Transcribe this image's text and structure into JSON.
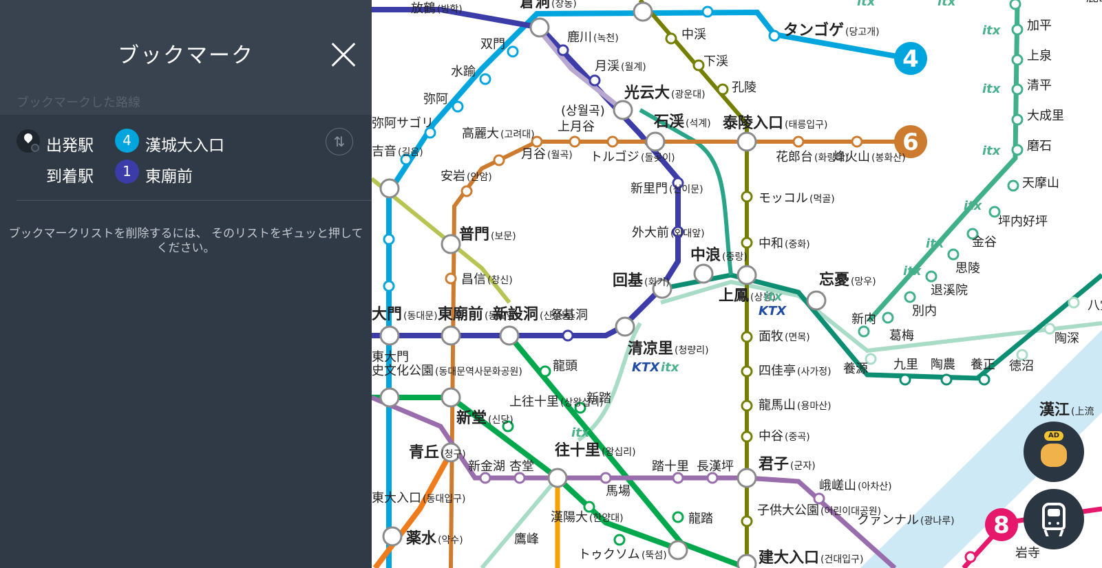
{
  "panel": {
    "title": "ブックマーク",
    "section_label": "ブックマークした路線",
    "origin_label": "出発駅",
    "destination_label": "到着駅",
    "origin": {
      "line_num": "4",
      "line_color": "#00a5de",
      "station": "漢城大入口"
    },
    "destination": {
      "line_num": "1",
      "line_color": "#3c3ca8",
      "station": "東廟前"
    },
    "note": "ブックマークリストを削除するには、 そのリストをギュッと押してください。"
  },
  "map": {
    "colors": {
      "line1": "#3c3ca8",
      "line2": "#00a84d",
      "line3": "#ef7c1c",
      "line4": "#00a5de",
      "line5": "#996cac",
      "line6": "#cd7c2f",
      "line7": "#747f00",
      "line8": "#e6186c",
      "gyeongui": "#77c4a3",
      "gyeongchun": "#0c8e72",
      "ujin": "#b7c452",
      "suin": "#f5a200",
      "han_river": "#c8e6f5"
    },
    "line_badges": [
      {
        "num": "4",
        "color": "#00a5de"
      },
      {
        "num": "6",
        "color": "#cd7c2f"
      },
      {
        "num": "8",
        "color": "#e6186c"
      }
    ],
    "stations": [
      {
        "jp": "放鶴",
        "kr": "(방학)"
      },
      {
        "jp": "倉洞",
        "kr": "(창동)"
      },
      {
        "jp": "中渓",
        "kr": ""
      },
      {
        "jp": "タンゴゲ",
        "kr": "(당고개)"
      },
      {
        "jp": "双門",
        "kr": ""
      },
      {
        "jp": "鹿川",
        "kr": "(녹천)"
      },
      {
        "jp": "下渓",
        "kr": ""
      },
      {
        "jp": "孔陵",
        "kr": ""
      },
      {
        "jp": "水踰",
        "kr": ""
      },
      {
        "jp": "月渓",
        "kr": "(월계)"
      },
      {
        "jp": "光云大",
        "kr": "(광운대)"
      },
      {
        "jp": "弥阿",
        "kr": ""
      },
      {
        "jp": "弥阿サゴリ",
        "kr": ""
      },
      {
        "jp": "吉音",
        "kr": "(길음)"
      },
      {
        "jp": "石渓",
        "kr": "(석계)"
      },
      {
        "jp": "泰陵入口",
        "kr": "(태릉입구)"
      },
      {
        "jp": "(상월곡)",
        "kr": ""
      },
      {
        "jp": "上月谷",
        "kr": ""
      },
      {
        "jp": "高麗大",
        "kr": "(고려대)"
      },
      {
        "jp": "月谷",
        "kr": "(월곡)"
      },
      {
        "jp": "トルゴジ",
        "kr": "(돌곶이)"
      },
      {
        "jp": "花郎台",
        "kr": "(화랑대)"
      },
      {
        "jp": "烽火山",
        "kr": "(봉화산)"
      },
      {
        "jp": "安岩",
        "kr": "(안암)"
      },
      {
        "jp": "新里門",
        "kr": "(신이문)"
      },
      {
        "jp": "モッコル",
        "kr": "(먹골)"
      },
      {
        "jp": "外大前",
        "kr": "(외대앞)"
      },
      {
        "jp": "中和",
        "kr": "(중화)"
      },
      {
        "jp": "普門",
        "kr": "(보문)"
      },
      {
        "jp": "中浪",
        "kr": "(중랑)"
      },
      {
        "jp": "昌信",
        "kr": "(창신)"
      },
      {
        "jp": "回基",
        "kr": "(회기)"
      },
      {
        "jp": "上鳳",
        "kr": "(상봉)"
      },
      {
        "jp": "忘憂",
        "kr": "(망우)"
      },
      {
        "jp": "大門",
        "kr": "(동대문)"
      },
      {
        "jp": "東廟前",
        "kr": "(동묘앞)"
      },
      {
        "jp": "新設洞",
        "kr": "(신설동)"
      },
      {
        "jp": "祭基洞",
        "kr": ""
      },
      {
        "jp": "清凉里",
        "kr": "(청량리)"
      },
      {
        "jp": "新内",
        "kr": ""
      },
      {
        "jp": "葛梅",
        "kr": ""
      },
      {
        "jp": "別内",
        "kr": ""
      },
      {
        "jp": "退溪院",
        "kr": ""
      },
      {
        "jp": "思陵",
        "kr": ""
      },
      {
        "jp": "面牧",
        "kr": "(면목)"
      },
      {
        "jp": "東大門",
        "kr": ""
      },
      {
        "jp": "史文化公園",
        "kr": "(동대문역사문화공원)"
      },
      {
        "jp": "龍頭",
        "kr": ""
      },
      {
        "jp": "四佳亭",
        "kr": "(사가정)"
      },
      {
        "jp": "養源",
        "kr": ""
      },
      {
        "jp": "九里",
        "kr": ""
      },
      {
        "jp": "陶農",
        "kr": ""
      },
      {
        "jp": "養正",
        "kr": ""
      },
      {
        "jp": "徳沼",
        "kr": ""
      },
      {
        "jp": "陶深",
        "kr": ""
      },
      {
        "jp": "新踏",
        "kr": ""
      },
      {
        "jp": "上往十里",
        "kr": "(상왕십리)"
      },
      {
        "jp": "新堂",
        "kr": "(신당)"
      },
      {
        "jp": "龍馬山",
        "kr": "(용마산)"
      },
      {
        "jp": "往十里",
        "kr": "(왕십리)"
      },
      {
        "jp": "中谷",
        "kr": "(중곡)"
      },
      {
        "jp": "青丘",
        "kr": "(청구)"
      },
      {
        "jp": "新金湖",
        "kr": ""
      },
      {
        "jp": "杏堂",
        "kr": ""
      },
      {
        "jp": "踏十里",
        "kr": ""
      },
      {
        "jp": "長漢坪",
        "kr": ""
      },
      {
        "jp": "君子",
        "kr": "(군자)"
      },
      {
        "jp": "峨嵯山",
        "kr": "(아차산)"
      },
      {
        "jp": "馬場",
        "kr": ""
      },
      {
        "jp": "東大入口",
        "kr": "(동대입구)"
      },
      {
        "jp": "子供大公園",
        "kr": "(어린이대공원)"
      },
      {
        "jp": "クァンナル",
        "kr": "(광나루)"
      },
      {
        "jp": "漢陽大",
        "kr": "(한양대)"
      },
      {
        "jp": "龍踏",
        "kr": ""
      },
      {
        "jp": "薬水",
        "kr": "(약수)"
      },
      {
        "jp": "鷹峰",
        "kr": ""
      },
      {
        "jp": "トゥクソム",
        "kr": "(뚝섬)"
      },
      {
        "jp": "建大入口",
        "kr": "(건대입구)"
      },
      {
        "jp": "岩寺",
        "kr": ""
      },
      {
        "jp": "漢江",
        "kr": "(上流"
      },
      {
        "jp": "加平",
        "kr": ""
      },
      {
        "jp": "上泉",
        "kr": ""
      },
      {
        "jp": "清平",
        "kr": ""
      },
      {
        "jp": "大成里",
        "kr": ""
      },
      {
        "jp": "磨石",
        "kr": ""
      },
      {
        "jp": "天摩山",
        "kr": ""
      },
      {
        "jp": "坪内好坪",
        "kr": ""
      },
      {
        "jp": "金谷",
        "kr": ""
      },
      {
        "jp": "八堂",
        "kr": ""
      },
      {
        "jp": "鹿島",
        "kr": ""
      }
    ],
    "itx_label": "itx",
    "ktx_label": "KTX",
    "ad_label": "AD"
  }
}
